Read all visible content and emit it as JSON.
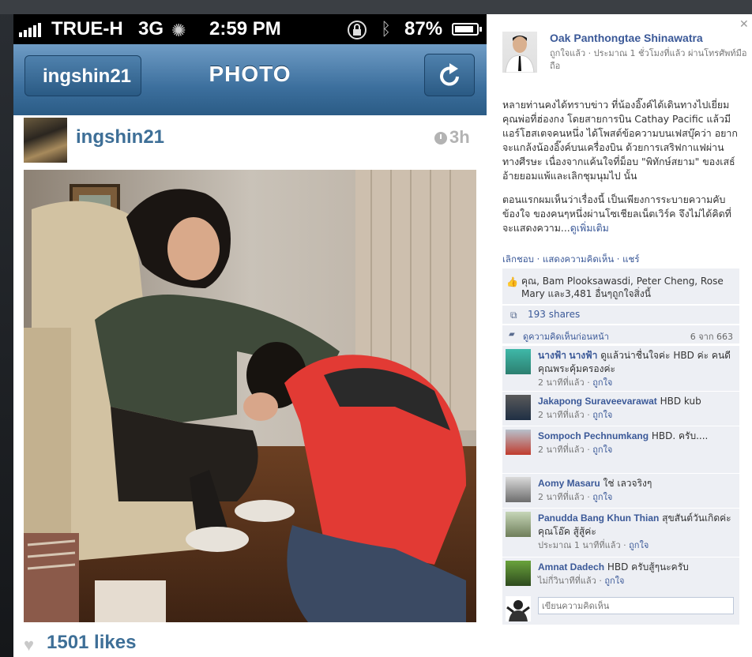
{
  "status_bar": {
    "carrier": "TRUE-H",
    "network": "3G",
    "time": "2:59 PM",
    "battery_percent": "87%",
    "battery_level": 0.87
  },
  "nav": {
    "back_label": "ingshin21",
    "title": "PHOTO",
    "icons": {
      "refresh": "refresh-icon",
      "lock": "rotation-lock-icon",
      "bluetooth": "bluetooth-icon"
    }
  },
  "post": {
    "username": "ingshin21",
    "age": "3h",
    "likes": "1501 likes"
  },
  "facebook": {
    "author": "Oak Panthongtae Shinawatra",
    "meta": "ถูกใจแล้ว · ประมาณ 1 ชั่วโมงที่แล้ว ผ่านโทรศัพท์มือถือ",
    "text_p1": "หลายท่านคงได้ทราบข่าว ที่น้องอิ๊งค์ได้เดินทางไปเยี่ยมคุณพ่อที่ฮ่องกง โดยสายการบิน Cathay Pacific แล้วมีแอร์โฮสเตจคนหนึ่ง ได้โพสต์ข้อความบนเฟสบุ๊คว่า อยากจะแกล้งน้องอิ๊งค์บนเครื่องบิน ด้วยการเสริฟกาแฟผ่านทางศีรษะ เนื่องจากแค้นใจที่ม็อบ \"พิทักษ์สยาม\" ของเสธ์อ้ายยอมแพ้และเลิกชุมนุมไป นั้น",
    "text_p2": "ตอนแรกผมเห็นว่าเรื่องนี้ เป็นเพียงการระบายความคับข้องใจ ของคนๆหนึ่งผ่านโซเชียลเน็ตเวิร์ค จึงไม่ได้คิดที่จะแสดงความ...",
    "see_more": "ดูเพิ่มเติม",
    "actions": "เลิกชอบ · แสดงความคิดเห็น · แชร์",
    "likes_line_1": "คุณ, Bam Plooksawasdi, Peter Cheng, Rose",
    "likes_line_2": "Mary และ3,481 อื่นๆถูกใจสิ่งนี้",
    "shares": "193 shares",
    "previous_comments": "ดูความคิดเห็นก่อนหน้า",
    "previous_count": "6 จาก 663",
    "comment_placeholder": "เขียนความคิดเห็น",
    "comments": [
      {
        "name": "นางฟ้า นางฟ้า",
        "text": "ดูแล้วน่าชื่นใจค่ะ HBD ค่ะ คนดีคุณพระคุ้มครองค่ะ",
        "time": "2 นาทีที่แล้ว",
        "like": "ถูกใจ"
      },
      {
        "name": "Jakapong Suraveevarawat",
        "text": "HBD kub",
        "time": "2 นาทีที่แล้ว",
        "like": "ถูกใจ"
      },
      {
        "name": "Sompoch Pechnumkang",
        "text": "HBD. ครับ....",
        "time": "2 นาทีที่แล้ว",
        "like": "ถูกใจ"
      },
      {
        "name": "Aomy Masaru",
        "text": "ใช่ เลวจริงๆ",
        "time": "2 นาทีที่แล้ว",
        "like": "ถูกใจ"
      },
      {
        "name": "Panudda Bang Khun Thian",
        "text": "สุขสันต์วันเกิดค่ะ คุณโอ๊ค สู้สู้ค่ะ",
        "time": "ประมาณ 1 นาทีที่แล้ว",
        "like": "ถูกใจ"
      },
      {
        "name": "Amnat Dadech",
        "text": "HBD ครับสู้ๆนะครับ",
        "time": "ไม่กี่วินาทีที่แล้ว",
        "like": "ถูกใจ"
      }
    ]
  },
  "colors": {
    "instagram_blue": "#3e6f97",
    "facebook_blue": "#3b5998",
    "comment_bg": "#edeff4"
  }
}
